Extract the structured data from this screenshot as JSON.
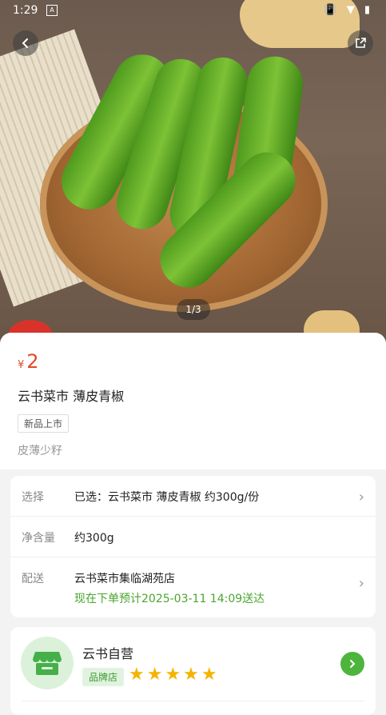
{
  "status_bar": {
    "time": "1:29",
    "sim_label": "A",
    "icons_text": "📳 ▼ ▮"
  },
  "gallery": {
    "counter": "1/3"
  },
  "product": {
    "currency": "¥",
    "price": "2",
    "title": "云书菜市 薄皮青椒",
    "tag": "新品上市",
    "subtitle": "皮薄少籽"
  },
  "details": [
    {
      "key": "选择",
      "value": "已选：云书菜市 薄皮青椒 约300g/份",
      "note": "",
      "chevron": true
    },
    {
      "key": "净含量",
      "value": "约300g",
      "note": "",
      "chevron": false
    },
    {
      "key": "配送",
      "value": "云书菜市集临湖苑店",
      "note": "现在下单预计2025-03-11 14:09送达",
      "chevron": true
    }
  ],
  "store": {
    "name": "云书自营",
    "badge": "品牌店",
    "rating": 5,
    "stars_text": "★★★★★"
  },
  "colors": {
    "price": "#e04a2a",
    "accent_green": "#4aa52f",
    "star": "#f5b300"
  }
}
